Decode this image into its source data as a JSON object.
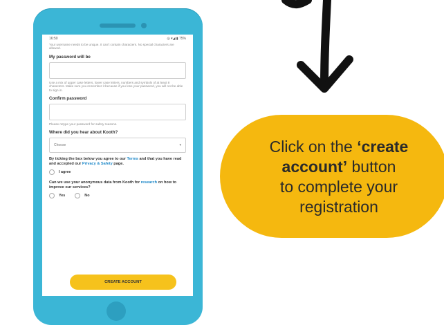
{
  "phone": {
    "status": {
      "time": "16:50",
      "icons": "◎ ▾◢ ▮ 75%"
    },
    "form": {
      "top_note": "Your username needs to be unique. It can't contain characters. No special characters are allowed.",
      "password_label": "My password will be",
      "password_hint": "Use a mix of upper case letters, lower case letters, numbers and symbols of at least 8 characters. Make sure you remember it because if you lose your password, you will not be able to sign in.",
      "confirm_label": "Confirm password",
      "confirm_hint": "Please retype your password for safety reasons.",
      "hear_label": "Where did you hear about Kooth?",
      "hear_value": "Choose",
      "terms_part1": "By ticking the box below you agree to our ",
      "terms_link": "Terms",
      "terms_part2": " and that you have read and accepted our ",
      "privacy_link": "Privacy & Safety",
      "terms_part3": " page.",
      "agree_label": "I agree",
      "research_part1": "Can we use your anonymous data from Kooth for ",
      "research_link": "research",
      "research_part2": " on how to improve our services?",
      "yes_label": "Yes",
      "no_label": "No",
      "create_button": "CREATE ACCOUNT"
    }
  },
  "callout": {
    "line1_prefix": "Click on the ",
    "line1_bold": "‘create",
    "line2_bold": "account’",
    "line2_rest": " button",
    "line3": "to complete your",
    "line4": "registration"
  },
  "colors": {
    "phone_body": "#3bb6d6",
    "accent_yellow": "#f5b80f",
    "button_yellow": "#f6c21c",
    "link_blue": "#1e88c8"
  }
}
